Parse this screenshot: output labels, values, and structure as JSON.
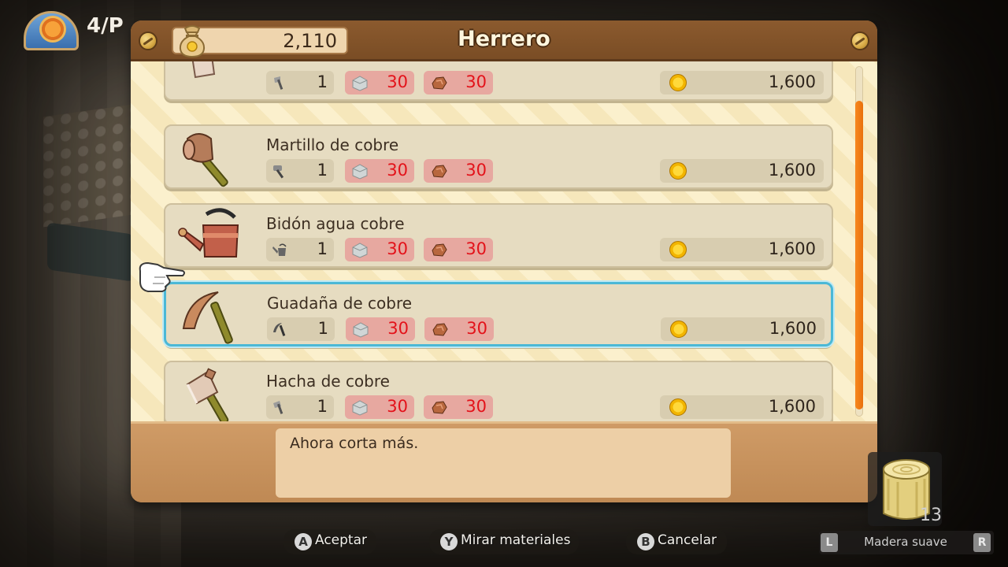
{
  "hud": {
    "date_text": "4/P"
  },
  "shop": {
    "title": "Herrero",
    "money": "2,110"
  },
  "items": [
    {
      "name": "",
      "icon": "axe-icon",
      "tool_qty": "1",
      "mat1_qty": "30",
      "mat2_qty": "30",
      "price": "1,600"
    },
    {
      "name": "Martillo de cobre",
      "icon": "hammer-icon",
      "tool_qty": "1",
      "mat1_qty": "30",
      "mat2_qty": "30",
      "price": "1,600"
    },
    {
      "name": "Bidón agua cobre",
      "icon": "watering-can-icon",
      "tool_qty": "1",
      "mat1_qty": "30",
      "mat2_qty": "30",
      "price": "1,600"
    },
    {
      "name": "Guadaña de cobre",
      "icon": "sickle-icon",
      "tool_qty": "1",
      "mat1_qty": "30",
      "mat2_qty": "30",
      "price": "1,600"
    },
    {
      "name": "Hacha de cobre",
      "icon": "axe-icon",
      "tool_qty": "1",
      "mat1_qty": "30",
      "mat2_qty": "30",
      "price": "1,600"
    }
  ],
  "selected_index": 3,
  "description": "Ahora corta más.",
  "hints": {
    "accept_key": "A",
    "accept_label": "Aceptar",
    "materials_key": "Y",
    "materials_label": "Mirar materiales",
    "cancel_key": "B",
    "cancel_label": "Cancelar"
  },
  "inventory": {
    "count": "13",
    "item_name": "Madera suave",
    "left_key": "L",
    "right_key": "R"
  },
  "colors": {
    "selection_border": "#4bb8d6",
    "scrollbar": "#f7881f",
    "material_cost": "#e3121a"
  }
}
